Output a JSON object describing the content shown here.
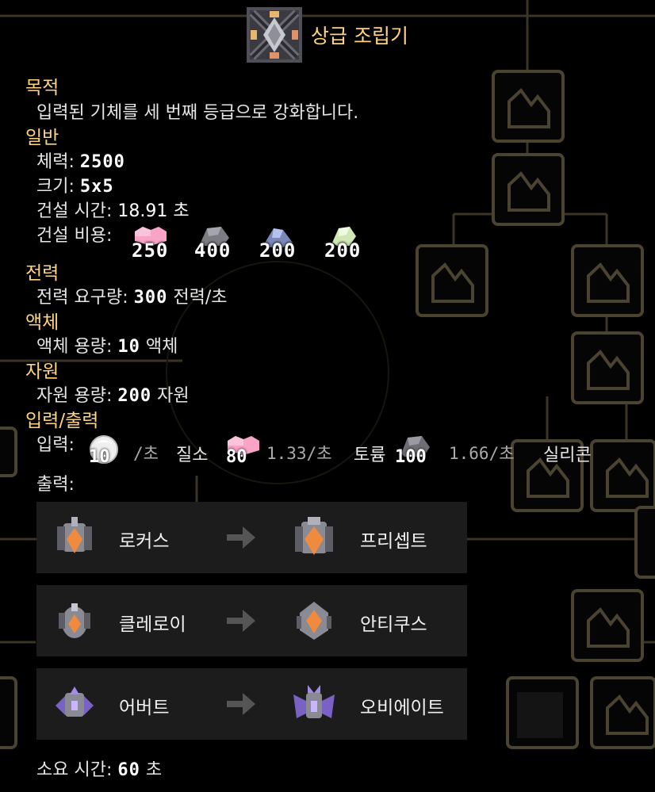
{
  "block": {
    "name": "상급 조립기",
    "icon": "tank-refabricator-icon"
  },
  "purpose": {
    "heading": "목적",
    "description": "입력된 기체를 세 번째 등급으로 강화합니다."
  },
  "general": {
    "heading": "일반",
    "health_label": "체력:",
    "health_value": "2500",
    "size_label": "크기:",
    "size_value": "5x5",
    "build_time_label": "건설 시간:",
    "build_time_value": "18.91 초",
    "build_cost_label": "건설 비용:",
    "build_cost": [
      {
        "item": "thorium",
        "amount": "250",
        "color": "#f9a3c7"
      },
      {
        "item": "plastanium",
        "amount": "400",
        "color": "#8a8a8a"
      },
      {
        "item": "titanium",
        "amount": "200",
        "color": "#8da1e3"
      },
      {
        "item": "surge-alloy",
        "amount": "200",
        "color": "#d4f0b0"
      }
    ]
  },
  "power": {
    "heading": "전력",
    "usage_label": "전력 요구량:",
    "usage_value": "300",
    "usage_unit": "전력/초"
  },
  "liquids": {
    "heading": "액체",
    "capacity_label": "액체 용량:",
    "capacity_value": "10",
    "capacity_unit": "액체"
  },
  "items": {
    "heading": "자원",
    "capacity_label": "자원 용량:",
    "capacity_value": "200",
    "capacity_unit": "자원"
  },
  "io": {
    "heading": "입력/출력",
    "input_label": "입력:",
    "inputs": [
      {
        "name": "질소",
        "amount": "10",
        "rate": "/초",
        "icon": "nitrogen-icon"
      },
      {
        "name": "토륨",
        "amount": "80",
        "rate": "1.33/초",
        "icon": "thorium-icon"
      },
      {
        "name": "실리콘",
        "amount": "100",
        "rate": "1.66/초",
        "icon": "silicon-icon"
      }
    ],
    "output_label": "출력:",
    "upgrades": [
      {
        "from": "로커스",
        "to": "프리셉트"
      },
      {
        "from": "클레로이",
        "to": "안티쿠스"
      },
      {
        "from": "어버트",
        "to": "오비에이트"
      }
    ]
  },
  "time_label": "소요 시간:",
  "time_value": "60",
  "time_unit": "초",
  "colors": {
    "accent": "#ffd37f",
    "panel": "#1c1c1c",
    "background": "#000000"
  }
}
